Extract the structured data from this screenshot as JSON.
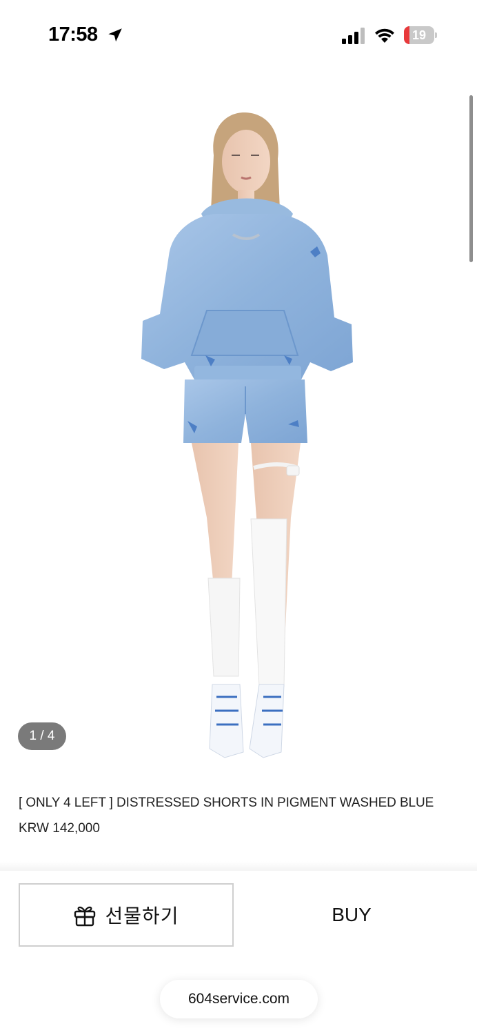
{
  "status_bar": {
    "time": "17:58",
    "battery_level": "19",
    "battery_fraction": 0.19,
    "icons": [
      "location-arrow-icon",
      "cellular-signal-icon",
      "wifi-icon",
      "battery-icon"
    ]
  },
  "gallery": {
    "pager": "1 / 4",
    "current": 1,
    "total": 4
  },
  "product": {
    "title": "[ ONLY 4 LEFT ] DISTRESSED SHORTS IN PIGMENT WASHED BLUE",
    "price": "KRW 142,000"
  },
  "actions": {
    "gift_label": "선물하기",
    "gift_icon": "gift-icon",
    "buy_label": "BUY"
  },
  "browser": {
    "url": "604service.com"
  },
  "colors": {
    "battery_low": "#e8393b",
    "denim": "#8fb3dc",
    "pager_bg": "#7a7a7a"
  }
}
